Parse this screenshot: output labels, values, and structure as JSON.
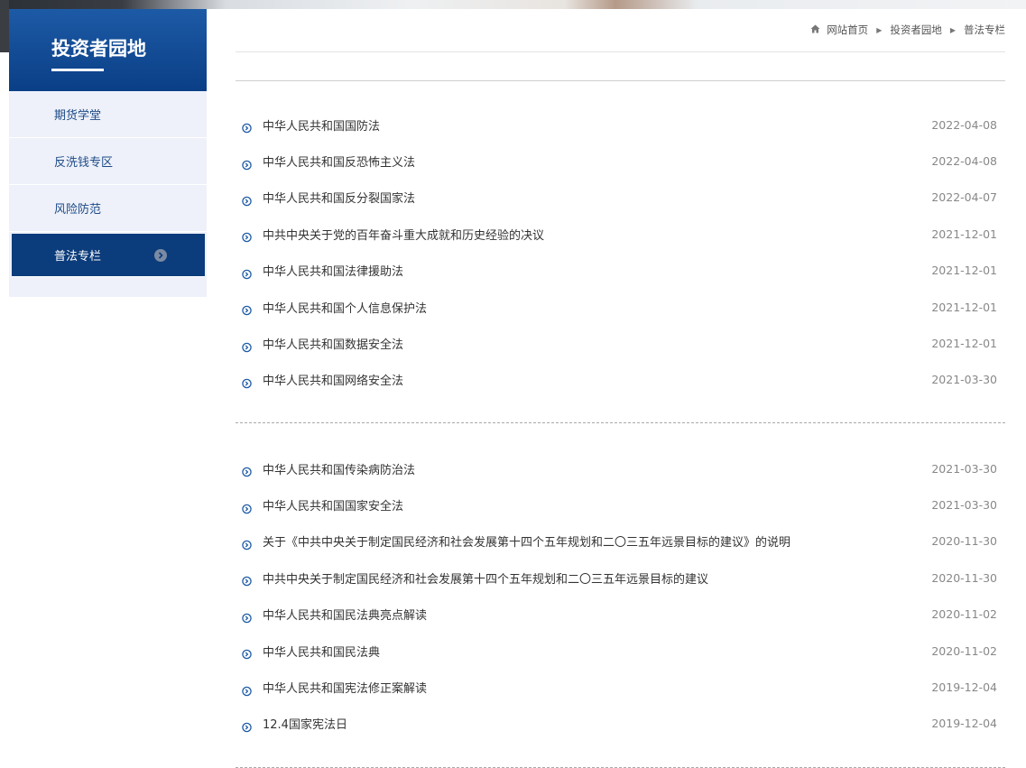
{
  "sidebar": {
    "title": "投资者园地",
    "items": [
      {
        "label": "期货学堂"
      },
      {
        "label": "反洗钱专区"
      },
      {
        "label": "风险防范"
      },
      {
        "label": "普法专栏"
      }
    ]
  },
  "breadcrumb": {
    "home": "网站首页",
    "level1": "投资者园地",
    "level2": "普法专栏"
  },
  "lists": [
    {
      "items": [
        {
          "title": "中华人民共和国国防法",
          "date": "2022-04-08"
        },
        {
          "title": "中华人民共和国反恐怖主义法",
          "date": "2022-04-08"
        },
        {
          "title": "中华人民共和国反分裂国家法",
          "date": "2022-04-07"
        },
        {
          "title": "中共中央关于党的百年奋斗重大成就和历史经验的决议",
          "date": "2021-12-01"
        },
        {
          "title": "中华人民共和国法律援助法",
          "date": "2021-12-01"
        },
        {
          "title": "中华人民共和国个人信息保护法",
          "date": "2021-12-01"
        },
        {
          "title": "中华人民共和国数据安全法",
          "date": "2021-12-01"
        },
        {
          "title": "中华人民共和国网络安全法",
          "date": "2021-03-30"
        }
      ]
    },
    {
      "items": [
        {
          "title": "中华人民共和国传染病防治法",
          "date": "2021-03-30"
        },
        {
          "title": "中华人民共和国国家安全法",
          "date": "2021-03-30"
        },
        {
          "title": "关于《中共中央关于制定国民经济和社会发展第十四个五年规划和二〇三五年远景目标的建议》的说明",
          "date": "2020-11-30"
        },
        {
          "title": "中共中央关于制定国民经济和社会发展第十四个五年规划和二〇三五年远景目标的建议",
          "date": "2020-11-30"
        },
        {
          "title": "中华人民共和国民法典亮点解读",
          "date": "2020-11-02"
        },
        {
          "title": "中华人民共和国民法典",
          "date": "2020-11-02"
        },
        {
          "title": "中华人民共和国宪法修正案解读",
          "date": "2019-12-04"
        },
        {
          "title": "12.4国家宪法日",
          "date": "2019-12-04"
        }
      ]
    }
  ],
  "colors": {
    "sidebar_header": "#0a3f86",
    "sidebar_bg": "#eef1fa",
    "active_item": "#0b3c7b",
    "link_blue": "#1c4a86",
    "bullet": "#1d5aa6",
    "date_gray": "#888888"
  },
  "icons": {
    "home": "home-icon",
    "breadcrumb_sep": "caret-right-icon",
    "active_chevron": "chevron-right-circle-icon",
    "bullet": "circle-chevron-icon"
  }
}
